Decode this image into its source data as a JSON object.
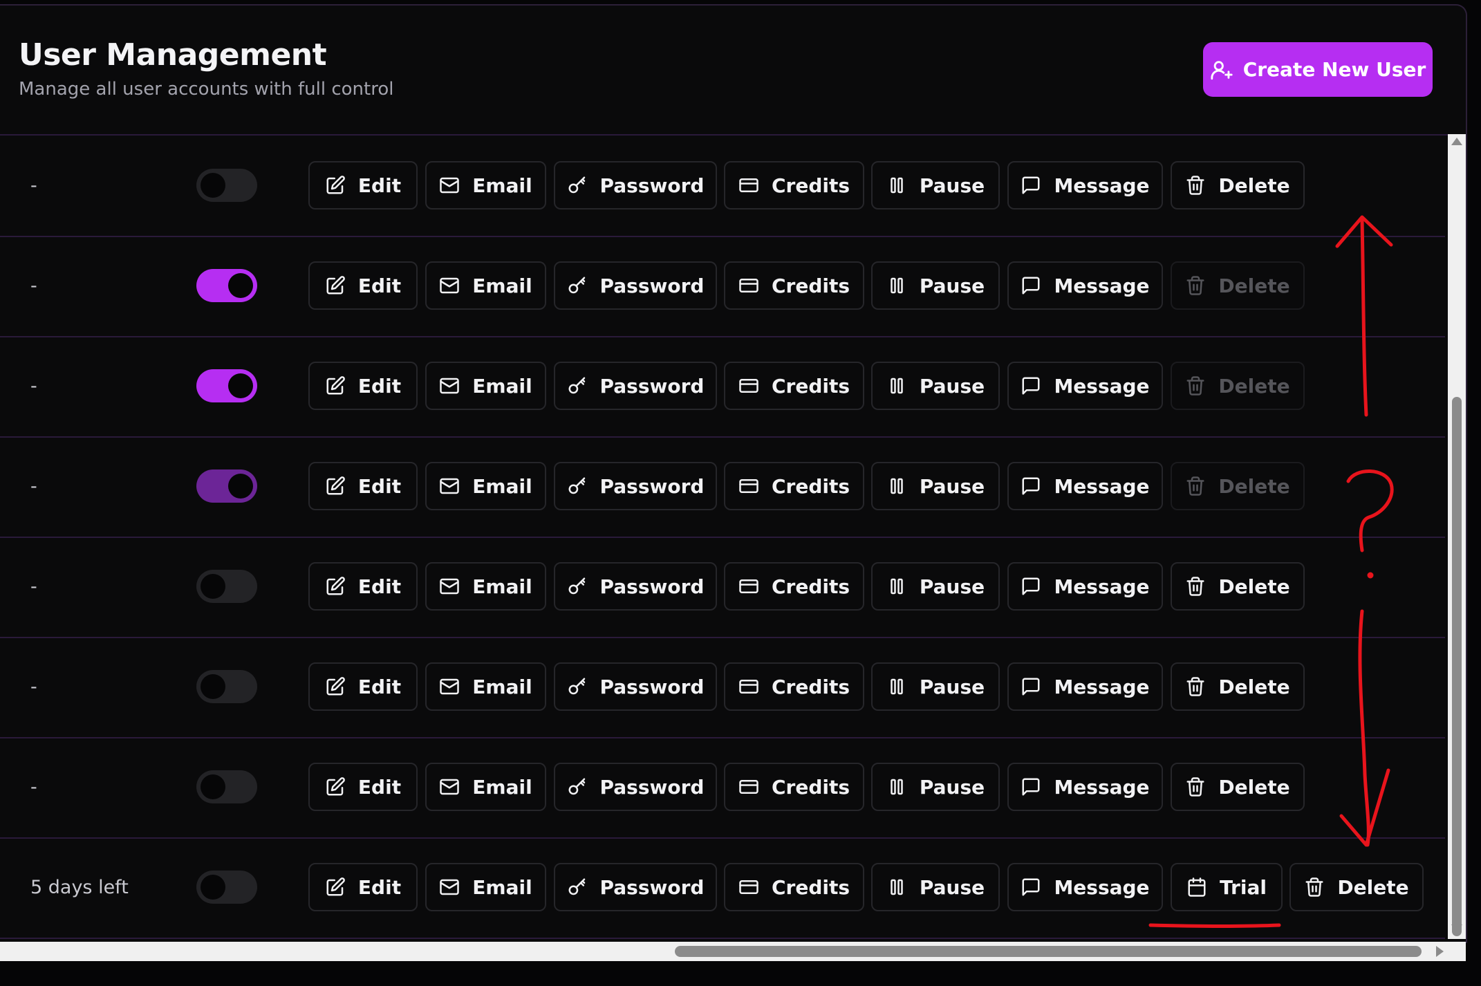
{
  "header": {
    "title": "User Management",
    "subtitle": "Manage all user accounts with full control",
    "create_label": "Create New User",
    "accent": "#b62ef2"
  },
  "actions": {
    "edit": "Edit",
    "email": "Email",
    "password": "Password",
    "credits": "Credits",
    "pause": "Pause",
    "message": "Message",
    "delete": "Delete",
    "trial": "Trial"
  },
  "rows": [
    {
      "status": "-",
      "toggle": "off",
      "delete_disabled": false,
      "has_trial": false
    },
    {
      "status": "-",
      "toggle": "on",
      "delete_disabled": true,
      "has_trial": false
    },
    {
      "status": "-",
      "toggle": "on",
      "delete_disabled": true,
      "has_trial": false
    },
    {
      "status": "-",
      "toggle": "on-dim",
      "delete_disabled": true,
      "has_trial": false
    },
    {
      "status": "-",
      "toggle": "off",
      "delete_disabled": false,
      "has_trial": false
    },
    {
      "status": "-",
      "toggle": "off",
      "delete_disabled": false,
      "has_trial": false
    },
    {
      "status": "-",
      "toggle": "off",
      "delete_disabled": false,
      "has_trial": false
    },
    {
      "status": "5 days left",
      "toggle": "off",
      "delete_disabled": false,
      "has_trial": true
    }
  ],
  "annotation": {
    "color": "#e8141c",
    "question_mark": "?"
  }
}
